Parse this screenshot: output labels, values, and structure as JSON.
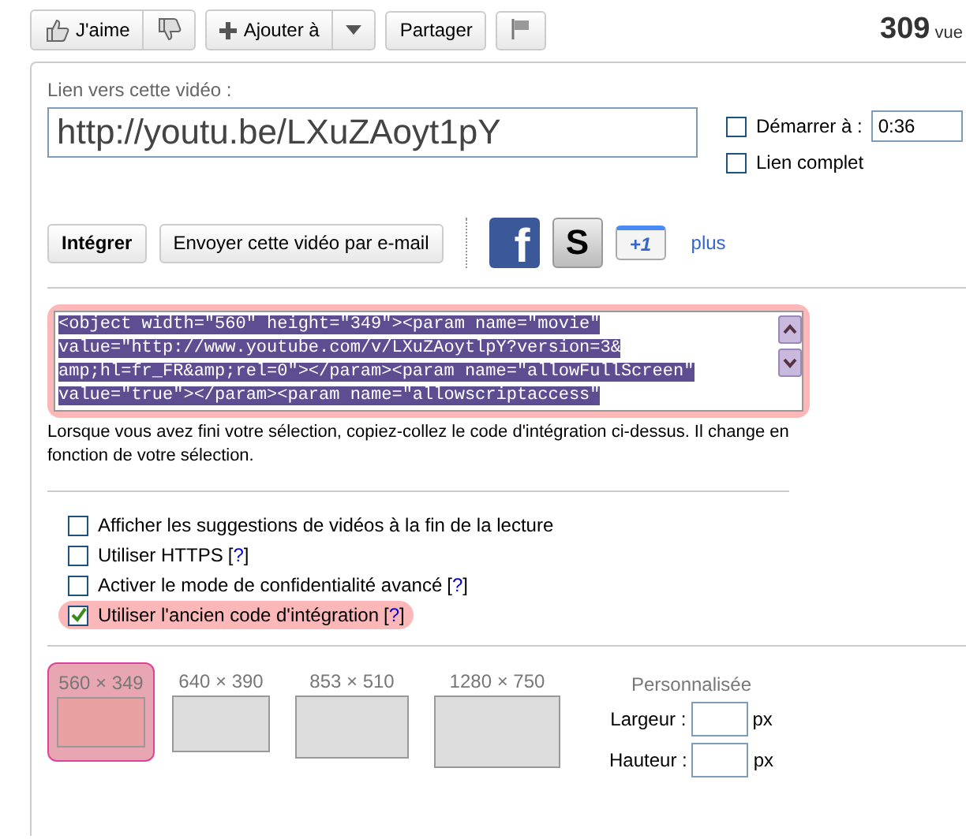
{
  "toolbar": {
    "like": "J'aime",
    "add": "Ajouter à",
    "share": "Partager",
    "views_count": "309",
    "views_label": "vue"
  },
  "link": {
    "label": "Lien vers cette vidéo :",
    "value": "http://youtu.be/LXuZAoyt1pY",
    "options": [
      {
        "label": "Démarrer à :",
        "checked": false,
        "value": "0:36"
      },
      {
        "label": "Lien complet",
        "checked": false
      }
    ]
  },
  "share_buttons": [
    {
      "label": "Intégrer",
      "selected": true
    },
    {
      "label": "Envoyer cette vidéo par e-mail",
      "selected": false
    }
  ],
  "social": [
    {
      "kind": "facebook",
      "glyph": "f"
    },
    {
      "kind": "star",
      "glyph": "S"
    },
    {
      "kind": "plusone",
      "glyph": "+1"
    }
  ],
  "more_link": "plus",
  "embed": {
    "highlighted": true,
    "lines": [
      "<object width=\"560\" height=\"349\"><param name=\"movie\"",
      "value=\"http://www.youtube.com/v/LXuZAoytlpY?version=3&",
      "amp;hl=fr_FR&amp;rel=0\"></param><param name=\"allowFullScreen\"",
      "value=\"true\"></param><param name=\"allowscriptaccess\""
    ]
  },
  "help_text": "Lorsque vous avez fini votre sélection, copiez-collez le code d'intégration ci-dessus. Il change en fonction de votre sélection.",
  "checkboxes": [
    {
      "label": "Afficher les suggestions de vidéos à la fin de la lecture",
      "checked": false,
      "highlighted": false
    },
    {
      "label": "Utiliser HTTPS",
      "help": {
        "open": "[",
        "mark": "?",
        "close": "]"
      },
      "checked": false,
      "highlighted": false
    },
    {
      "label": "Activer le mode de confidentialité avancé",
      "help": {
        "open": "[",
        "mark": "?",
        "close": "]"
      },
      "checked": false,
      "highlighted": false
    },
    {
      "label": "Utiliser l'ancien code d'intégration",
      "help": {
        "open": "[",
        "mark": "?",
        "close": "]"
      },
      "checked": true,
      "highlighted": true
    }
  ],
  "sizes": [
    {
      "label": "560 × 349",
      "selected": true
    },
    {
      "label": "640 × 390",
      "selected": false
    },
    {
      "label": "853 × 510",
      "selected": false
    },
    {
      "label": "1280 × 750",
      "selected": false
    }
  ],
  "custom": {
    "title": "Personnalisée",
    "fields": [
      {
        "label": "Largeur :",
        "unit": "px"
      },
      {
        "label": "Hauteur :",
        "unit": "px"
      }
    ]
  }
}
